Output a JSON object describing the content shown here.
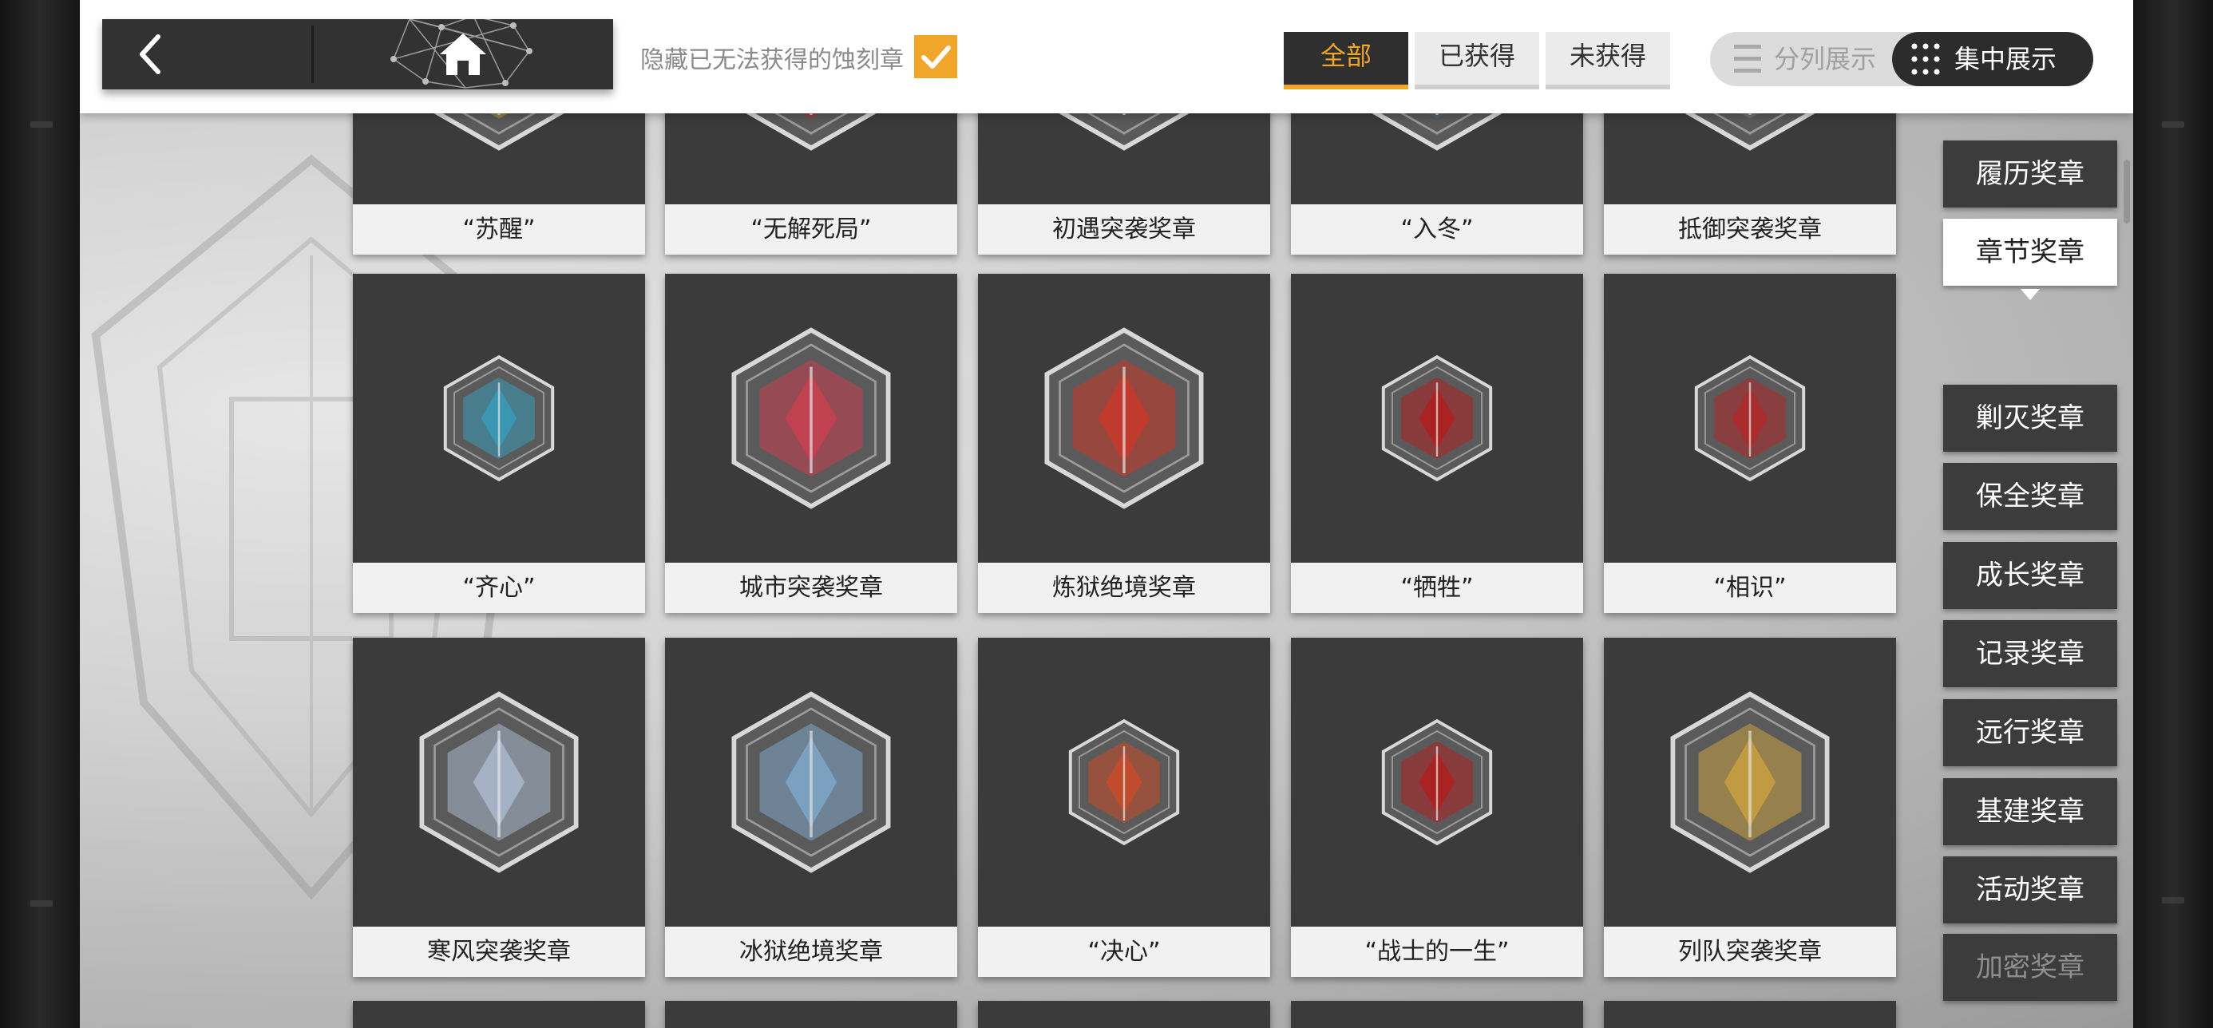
{
  "topbar": {
    "hide_label": "隐藏已无法获得的蚀刻章",
    "filters": [
      {
        "label": "全部",
        "active": true
      },
      {
        "label": "已获得",
        "active": false
      },
      {
        "label": "未获得",
        "active": false
      }
    ],
    "view_split": "分列展示",
    "view_focus": "集中展示"
  },
  "medals": {
    "row0": [
      "“苏醒”",
      "“无解死局”",
      "初遇突袭奖章",
      "“入冬”",
      "抵御突袭奖章"
    ],
    "row1": [
      "“齐心”",
      "城市突袭奖章",
      "炼狱绝境奖章",
      "“牺牲”",
      "“相识”"
    ],
    "row2": [
      "寒风突袭奖章",
      "冰狱绝境奖章",
      "“决心”",
      "“战士的一生”",
      "列队突袭奖章"
    ]
  },
  "sidebar": {
    "items": [
      "履历奖章",
      "章节奖章",
      "剿灭奖章",
      "保全奖章",
      "成长奖章",
      "记录奖章",
      "远行奖章",
      "基建奖章",
      "活动奖章",
      "加密奖章"
    ],
    "active_index": 1
  },
  "colors": {
    "accent": "#f0a62a",
    "card": "#3b3b3b",
    "menu": "#3c3c3c"
  },
  "icons": {
    "back": "chevron-left-icon",
    "home": "home-icon",
    "check": "checkmark-icon",
    "split": "list-icon",
    "focus": "grid-icon"
  }
}
